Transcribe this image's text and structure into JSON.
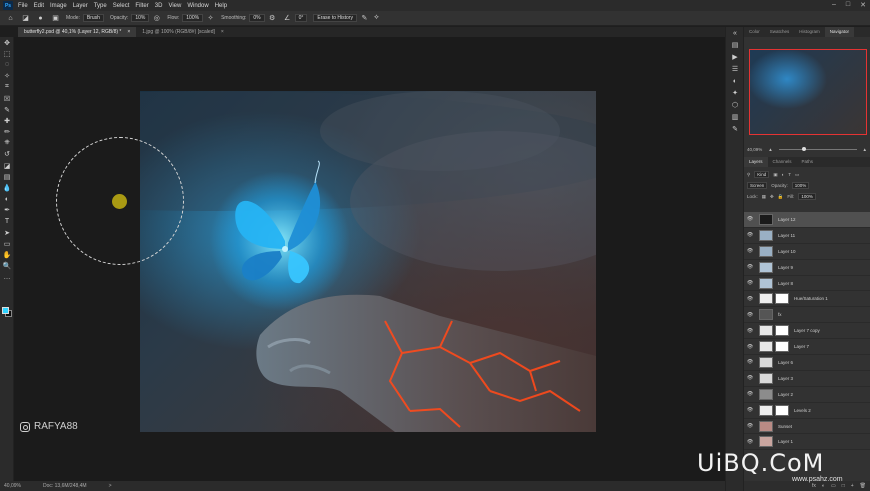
{
  "menu": {
    "logo": "Ps",
    "items": [
      "File",
      "Edit",
      "Image",
      "Layer",
      "Type",
      "Select",
      "Filter",
      "3D",
      "View",
      "Window",
      "Help"
    ],
    "window_controls": [
      "–",
      "□",
      "✕"
    ]
  },
  "options": {
    "mode_label": "Mode:",
    "mode_value": "Brush",
    "opacity_label": "Opacity:",
    "opacity_value": "10%",
    "flow_label": "Flow:",
    "flow_value": "100%",
    "smoothing_label": "Smoothing:",
    "smoothing_value": "0%",
    "angle_value": "0°",
    "erase_label": "Erase to History"
  },
  "tabs": [
    {
      "label": "butterfly2.psd @ 40,1% (Layer 12, RGB/8) *",
      "close": "×"
    },
    {
      "label": "1.jpg @ 100% (RGB/8#) [scaled]",
      "close": "×"
    }
  ],
  "tools": [
    "move",
    "marquee",
    "lasso",
    "quick-select",
    "crop",
    "frame",
    "eyedropper",
    "spot-heal",
    "brush",
    "clone-stamp",
    "history-brush",
    "eraser",
    "gradient",
    "blur",
    "dodge",
    "pen",
    "type",
    "path-select",
    "rectangle",
    "hand",
    "zoom",
    "more"
  ],
  "tool_glyphs": [
    "✥",
    "⬚",
    "◌",
    "✧",
    "⌗",
    "☒",
    "✎",
    "✚",
    "✏",
    "⎈",
    "↺",
    "◪",
    "▤",
    "💧",
    "◐",
    "✒",
    "T",
    "➤",
    "▭",
    "✋",
    "🔍",
    "…"
  ],
  "watermark_left": "RAFYA88",
  "status": {
    "zoom": "40,09%",
    "doc": "Doc: 13,6M/248,4M",
    "arrow": ">"
  },
  "panel": {
    "top_tabs": [
      "Color",
      "Swatches",
      "Histogram",
      "Navigator"
    ],
    "active_top_tab": "Navigator",
    "zoom": "40,09%",
    "layer_tabs": [
      "Layers",
      "Channels",
      "Paths"
    ],
    "kind_label": "Kind",
    "blend_mode": "Screen",
    "opacity_label": "Opacity:",
    "opacity_value": "100%",
    "lock_label": "Lock:",
    "fill_label": "Fill:",
    "fill_value": "100%"
  },
  "layers": [
    {
      "name": "Layer 12",
      "selected": true
    },
    {
      "name": "Layer 11"
    },
    {
      "name": "Layer 10"
    },
    {
      "name": "Layer 9"
    },
    {
      "name": "Layer 8"
    },
    {
      "name": "Hue/Saturation 1"
    },
    {
      "name": "fx"
    },
    {
      "name": "Layer 7 copy"
    },
    {
      "name": "Layer 7"
    },
    {
      "name": "Layer 6"
    },
    {
      "name": "Layer 3"
    },
    {
      "name": "Layer 2"
    },
    {
      "name": "Levels 2"
    },
    {
      "name": "Sunset"
    },
    {
      "name": "Layer 1"
    }
  ],
  "layer_footer": [
    "fx",
    "◐",
    "▭",
    "□",
    "+",
    "🗑"
  ],
  "watermark_right": {
    "brand": "UiBQ.CoM",
    "site": "www.psahz.com"
  }
}
